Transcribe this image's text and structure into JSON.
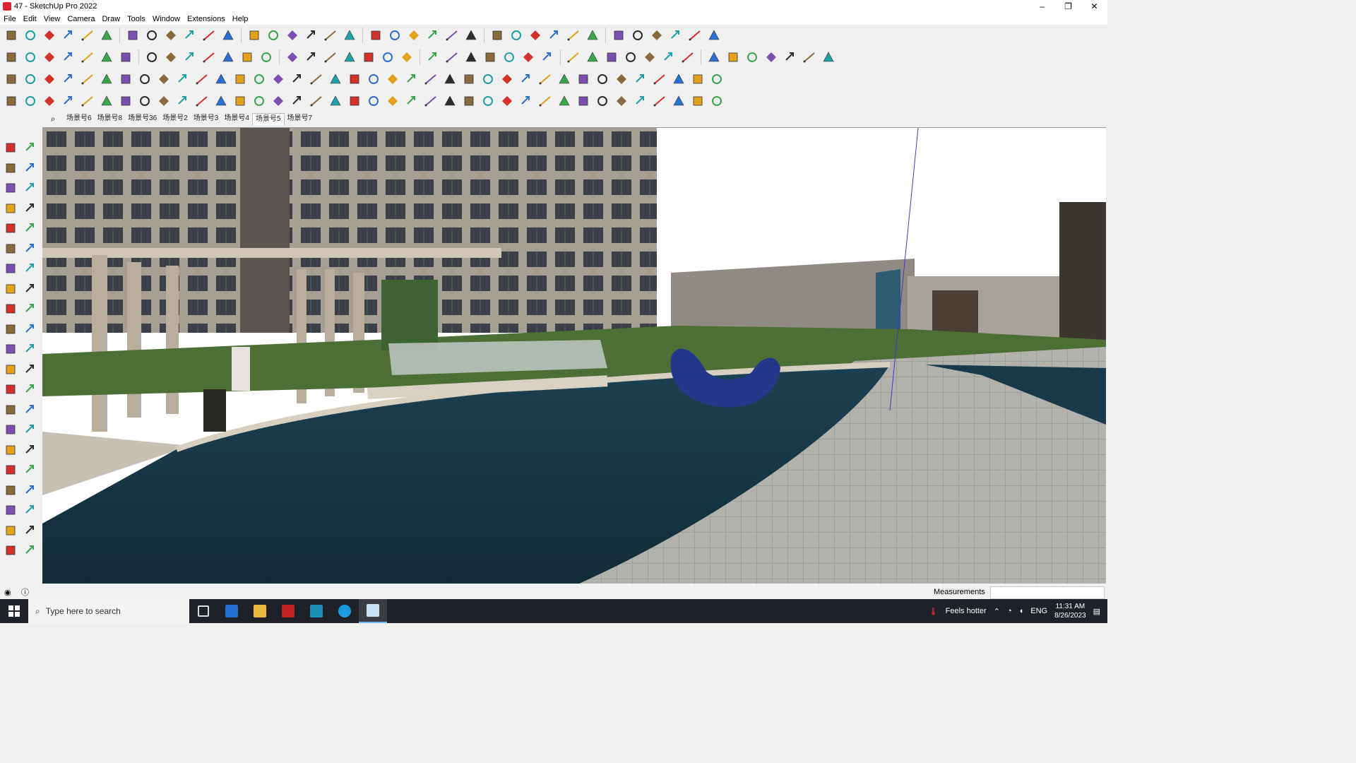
{
  "window": {
    "title": "47 - SketchUp Pro 2022",
    "minimize": "–",
    "maximize": "❐",
    "close": "✕"
  },
  "menu": [
    "File",
    "Edit",
    "View",
    "Camera",
    "Draw",
    "Tools",
    "Window",
    "Extensions",
    "Help"
  ],
  "scenes": {
    "tabs": [
      "场景号6",
      "场景号8",
      "场景号36",
      "场景号2",
      "场景号3",
      "场景号4",
      "场景号5",
      "场景号7"
    ],
    "active_index": 6
  },
  "status": {
    "measurements_label": "Measurements",
    "measurements_value": ""
  },
  "taskbar": {
    "search_placeholder": "Type here to search",
    "weather": "Feels hotter",
    "language": "ENG",
    "time": "11:31 AM",
    "date": "8/26/2023",
    "apps": [
      "task-view",
      "calculator",
      "file-explorer",
      "acrobat",
      "sketchup-3",
      "edge",
      "sketchup"
    ]
  },
  "colors": {
    "accent": "#0078d7",
    "taskbar": "#1e2127",
    "water": "#173a4a",
    "paving": "#a9a9a3"
  }
}
